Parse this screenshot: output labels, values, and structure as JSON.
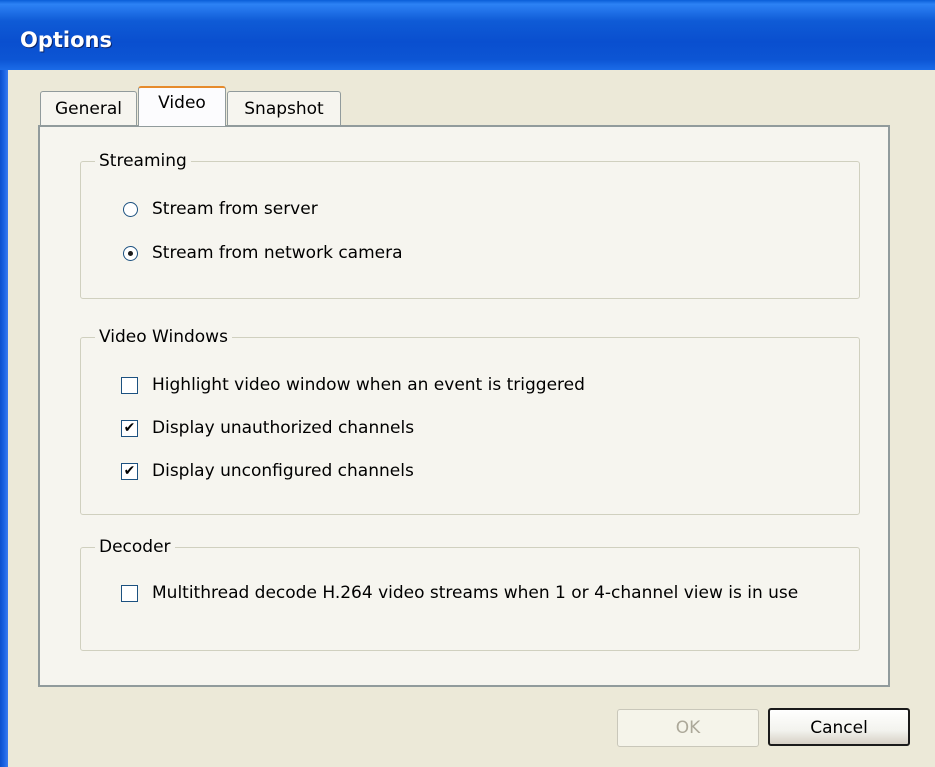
{
  "window": {
    "title": "Options"
  },
  "tabs": [
    {
      "label": "General",
      "active": false
    },
    {
      "label": "Video",
      "active": true
    },
    {
      "label": "Snapshot",
      "active": false
    }
  ],
  "streaming": {
    "label": "Streaming",
    "options": [
      {
        "label": "Stream from server",
        "selected": false
      },
      {
        "label": "Stream from network camera",
        "selected": true
      }
    ]
  },
  "video_windows": {
    "label": "Video Windows",
    "options": [
      {
        "label": "Highlight video window when an event is triggered",
        "checked": false
      },
      {
        "label": "Display unauthorized channels",
        "checked": true
      },
      {
        "label": "Display unconfigured channels",
        "checked": true
      }
    ]
  },
  "decoder": {
    "label": "Decoder",
    "options": [
      {
        "label": "Multithread decode H.264 video streams when 1 or 4-channel view is in use",
        "checked": false
      }
    ]
  },
  "buttons": {
    "ok": "OK",
    "cancel": "Cancel"
  },
  "colors": {
    "titlebar": "#0a4fcf",
    "dialog_bg": "#ece9d8",
    "active_tab_accent": "#e68b2c"
  }
}
